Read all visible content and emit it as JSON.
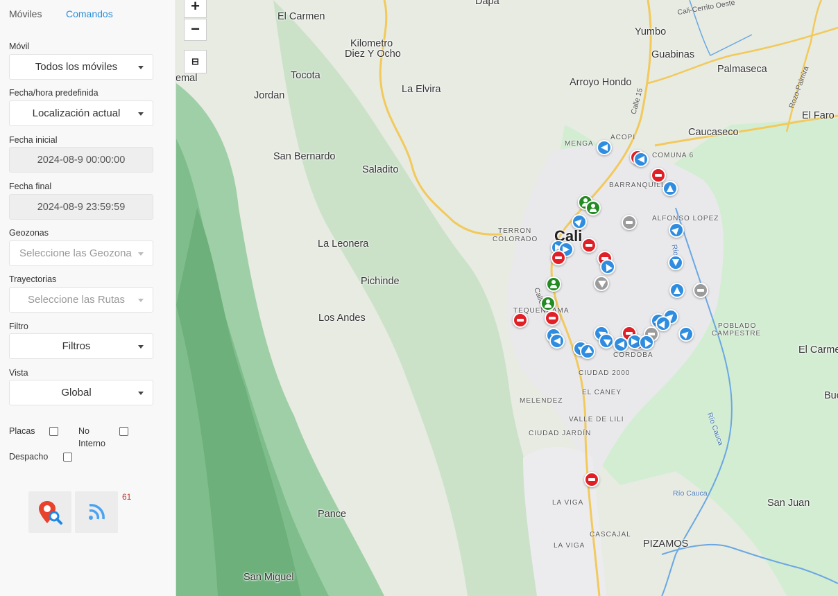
{
  "tabs": {
    "moviles": "Móviles",
    "comandos": "Comandos"
  },
  "form": {
    "movil": {
      "label": "Móvil",
      "value": "Todos los móviles"
    },
    "fecha_predef": {
      "label": "Fecha/hora predefinida",
      "value": "Localización actual"
    },
    "fecha_inicial": {
      "label": "Fecha inicial",
      "value": "2024-08-9 00:00:00"
    },
    "fecha_final": {
      "label": "Fecha final",
      "value": "2024-08-9 23:59:59"
    },
    "geozonas": {
      "label": "Geozonas",
      "placeholder": "Seleccione las Geozona"
    },
    "trayectorias": {
      "label": "Trayectorias",
      "placeholder": "Seleccione las Rutas"
    },
    "filtro": {
      "label": "Filtro",
      "value": "Filtros"
    },
    "vista": {
      "label": "Vista",
      "value": "Global"
    }
  },
  "checks": {
    "placas": "Placas",
    "no_interno_1": "No",
    "no_interno_2": "Interno",
    "despacho": "Despacho"
  },
  "tools": {
    "badge": "61",
    "search_icon": "map-pin-search-icon",
    "rss_icon": "rss-feed-icon"
  },
  "map": {
    "zoom_in": "+",
    "zoom_out": "−",
    "layers_icon": "layers-icon",
    "places": {
      "dapa": "Dapa",
      "el_carmen": "El Carmen",
      "kilometro": "Kilometro",
      "diez_y_ocho": "Diez Y Ocho",
      "tocota": "Tocota",
      "la_elvira": "La Elvira",
      "jordan": "Jordan",
      "emal": "emal",
      "san_bernardo": "San Bernardo",
      "saladito": "Saladito",
      "la_leonera": "La Leonera",
      "pichinde": "Pichinde",
      "los_andes": "Los Andes",
      "pance": "Pance",
      "san_miguel": "San Miguel",
      "yumbo": "Yumbo",
      "guabinas": "Guabinas",
      "palmaseca": "Palmaseca",
      "arroyo_hondo": "Arroyo Hondo",
      "el_faro": "El Faro",
      "caucaseco": "Caucaseco",
      "cali": "Cali",
      "el_carme_e": "El Carme",
      "buc": "Buc",
      "san_juan": "San Juan",
      "pizamos": "PIZAMOS"
    },
    "neighborhoods": {
      "acopi": "ACOPI",
      "menga": "MENGA",
      "comuna6": "COMUNA 6",
      "barranquilla": "BARRANQUILLA",
      "alfonso_lopez": "ALFONSO LOPEZ",
      "terron": "TERRON",
      "colorado": "COLORADO",
      "tequendama": "TEQUENDAMA",
      "poblado": "POBLADO",
      "campestre": "CAMPESTRE",
      "cordoba": "CÓRDOBA",
      "ciudad_2000": "CIUDAD 2000",
      "el_caney": "EL CANEY",
      "melendez": "MELENDEZ",
      "valle_de_lili": "VALLE DE LILI",
      "ciudad_jardin": "CIUDAD JARDÍN",
      "la_viga_1": "LA VIGA",
      "cascajal": "CASCAJAL",
      "la_viga_2": "LA VIGA"
    },
    "roads": {
      "cali_cerrito": "Cali-Cerrito Oeste",
      "calle15": "Calle 15",
      "rozo_palmira": "Rozo-Palmira",
      "calle5": "Calle 5",
      "rio_cauca_v": "Río Cauca",
      "rio_cauca_h": "Río Cauca",
      "rio_ca": "Río Ca"
    },
    "markers": {
      "total": 42,
      "by_status": {
        "moving": 26,
        "stopped_red": 10,
        "stopped_grey": 3,
        "person_green": 4
      },
      "colors": {
        "moving": "#2e8de0",
        "stopped": "#e01f26",
        "idle": "#9b9b9b",
        "person": "#228b22"
      }
    }
  }
}
